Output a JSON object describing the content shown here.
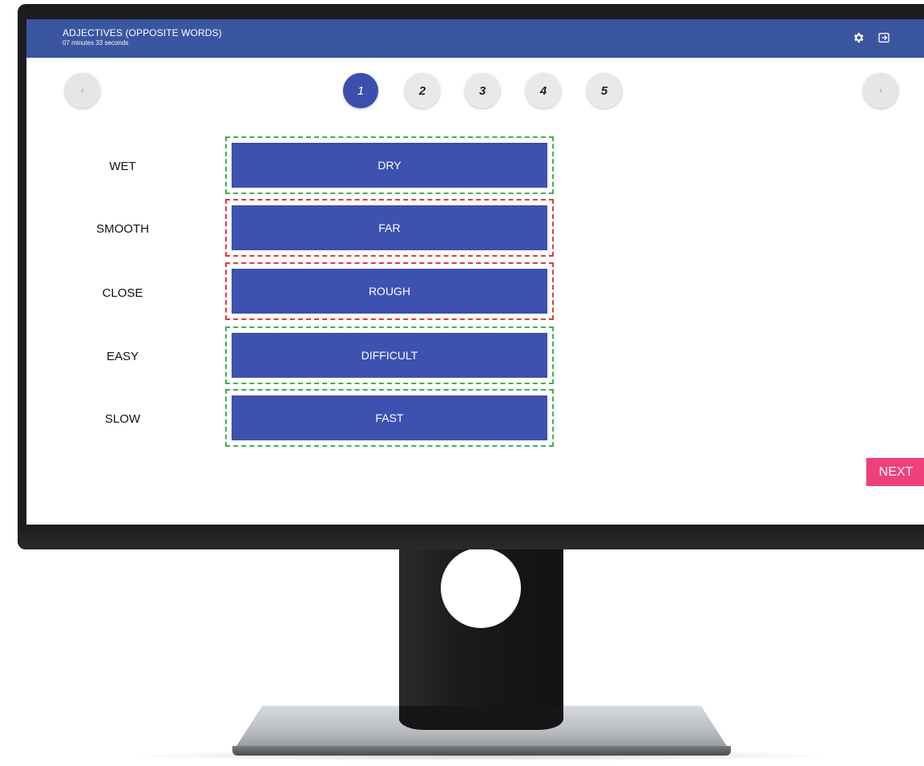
{
  "app": {
    "title": "ADJECTIVES (OPPOSITE WORDS)",
    "timer": "07 minutes 33 seconds",
    "header_icons": [
      "gear-icon",
      "exit-icon"
    ]
  },
  "pagination": {
    "prev_icon": "chevron-left-icon",
    "next_icon": "chevron-right-icon",
    "prev_glyph": "‹",
    "next_glyph": "›",
    "pages": [
      "1",
      "2",
      "3",
      "4",
      "5"
    ],
    "active_page": "1"
  },
  "rows": [
    {
      "word": "WET",
      "answer": "DRY",
      "status": "correct"
    },
    {
      "word": "SMOOTH",
      "answer": "FAR",
      "status": "wrong"
    },
    {
      "word": "CLOSE",
      "answer": "ROUGH",
      "status": "wrong"
    },
    {
      "word": "EASY",
      "answer": "DIFFICULT",
      "status": "correct"
    },
    {
      "word": "SLOW",
      "answer": "FAST",
      "status": "correct"
    }
  ],
  "actions": {
    "next_label": "NEXT"
  },
  "colors": {
    "header": "#3a56a0",
    "card": "#3d51b1",
    "correct_border": "#3fb34f",
    "wrong_border": "#e53a3a",
    "next_button": "#f0407a"
  }
}
